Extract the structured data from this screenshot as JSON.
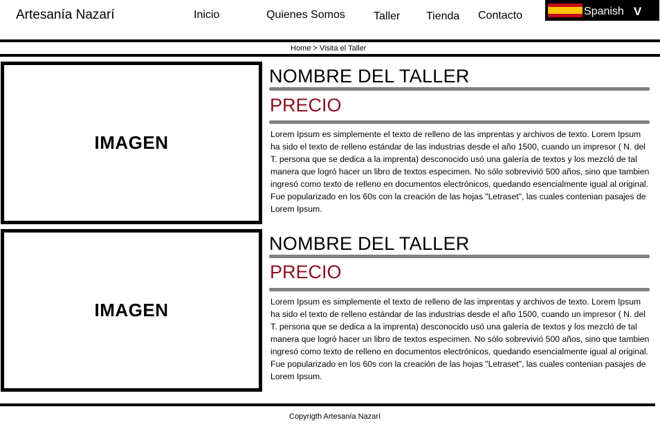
{
  "header": {
    "brand": "Artesanía Nazarí",
    "nav": [
      "Inicio",
      "Quienes Somos",
      "Taller",
      "Tienda",
      "Contacto"
    ],
    "language": {
      "label": "Spanish",
      "arrow": "V",
      "flag_colors": [
        "#c60b1e",
        "#ffc400",
        "#c60b1e"
      ]
    }
  },
  "breadcrumb": {
    "home": "Home",
    "separator": ">",
    "current": "Visita el Taller"
  },
  "items": [
    {
      "image_label": "IMAGEN",
      "title": "NOMBRE DEL TALLER",
      "price": "PRECIO",
      "description": "Lorem Ipsum es simplemente el texto de relleno de las imprentas y archivos de texto. Lorem Ipsum ha sido el texto de relleno estándar de las industrias desde el año 1500, cuando un impresor  ( N. del T. persona que se dedica a la imprenta)   desconocido usó una galería de textos y los mezcló de tal manera que logró hacer un libro de textos especimen. No sólo sobrevivió 500 años, sino que tambien ingresó como texto de relleno en documentos electrónicos, quedando esencialmente igual al original. Fue popularizado en los 60s con la creación de las hojas \"Letraset\", las cuales contenian pasajes de Lorem Ipsum."
    },
    {
      "image_label": "IMAGEN",
      "title": "NOMBRE DEL TALLER",
      "price": "PRECIO",
      "description": "Lorem Ipsum es simplemente el texto de relleno de las imprentas y archivos de texto. Lorem Ipsum ha sido el texto de relleno estándar de las industrias desde el año 1500, cuando un impresor  ( N. del T. persona que se dedica a la imprenta)   desconocido usó una galería de textos y los mezcló de tal manera que logró hacer un libro de textos especimen. No sólo sobrevivió 500 años, sino que tambien ingresó como texto de relleno en documentos electrónicos, quedando esencialmente igual al original. Fue popularizado en los 60s con la creación de las hojas \"Letraset\", las cuales contenian pasajes de Lorem Ipsum."
    }
  ],
  "footer": {
    "copyright": "Copyrigth Artesanía Nazarí"
  },
  "colors": {
    "price": "#8b1020",
    "divider": "#808080"
  }
}
